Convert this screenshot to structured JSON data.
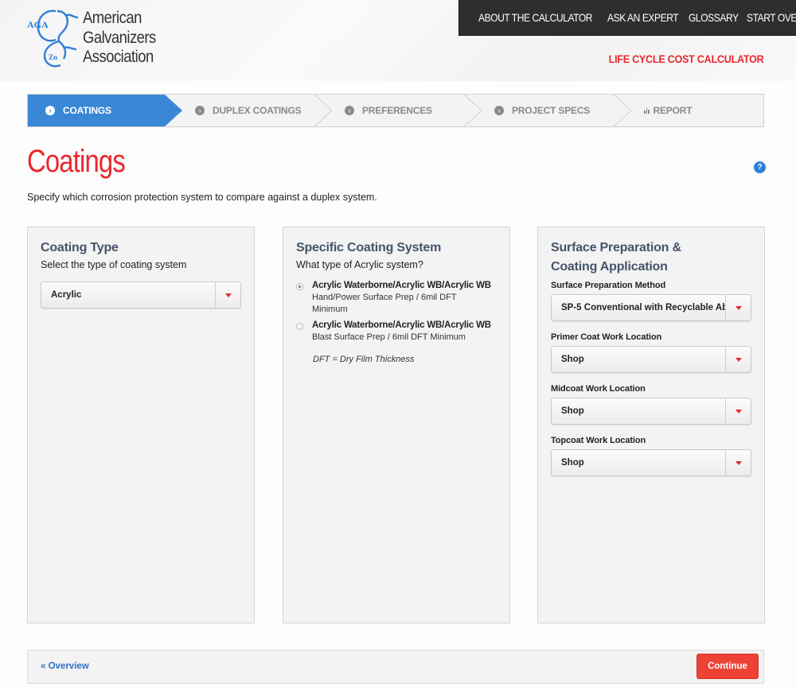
{
  "brand": {
    "logo_badge": "AGA",
    "logo_element": "Zn",
    "name_lines": [
      "American",
      "Galvanizers",
      "Association"
    ],
    "color_primary": "#3a87d6",
    "color_accent": "#e8292e"
  },
  "topnav": {
    "items": [
      "ABOUT THE CALCULATOR",
      "ASK AN EXPERT",
      "GLOSSARY",
      "START OVER"
    ]
  },
  "app_title": "LIFE CYCLE COST CALCULATOR",
  "steps": [
    {
      "label": "COATINGS",
      "icon": "chevron-circle-icon",
      "active": true
    },
    {
      "label": "DUPLEX COATINGS",
      "icon": "chevron-circle-icon",
      "active": false
    },
    {
      "label": "PREFERENCES",
      "icon": "chevron-circle-icon",
      "active": false
    },
    {
      "label": "PROJECT SPECS",
      "icon": "chevron-circle-icon",
      "active": false
    },
    {
      "label": "REPORT",
      "icon": "bar-chart-icon",
      "active": false
    }
  ],
  "page": {
    "title": "Coatings",
    "help_icon": "?",
    "subtitle": "Specify which corrosion protection system to compare against a duplex system."
  },
  "panels": {
    "coating_type": {
      "title": "Coating Type",
      "hint": "Select the type of coating system",
      "select_value": "Acrylic"
    },
    "specific_system": {
      "title": "Specific Coating System",
      "hint": "What type of Acrylic system?",
      "options": [
        {
          "title": "Acrylic Waterborne/Acrylic WB/Acrylic WB",
          "desc": "Hand/Power Surface Prep / 6mil DFT Minimum",
          "checked": true
        },
        {
          "title": "Acrylic Waterborne/Acrylic WB/Acrylic WB",
          "desc": "Blast Surface Prep / 6mil DFT Minimum",
          "checked": false
        }
      ],
      "note": "DFT = Dry Film Thickness"
    },
    "surface_prep": {
      "title_line1": "Surface Preparation &",
      "title_line2": "Coating Application",
      "fields": [
        {
          "label": "Surface Preparation Method",
          "value": "SP-5 Conventional with Recyclable Ab..."
        },
        {
          "label": "Primer Coat Work Location",
          "value": "Shop"
        },
        {
          "label": "Midcoat Work Location",
          "value": "Shop"
        },
        {
          "label": "Topcoat Work Location",
          "value": "Shop"
        }
      ]
    }
  },
  "footer": {
    "overview_link": "« Overview",
    "continue_label": "Continue"
  }
}
